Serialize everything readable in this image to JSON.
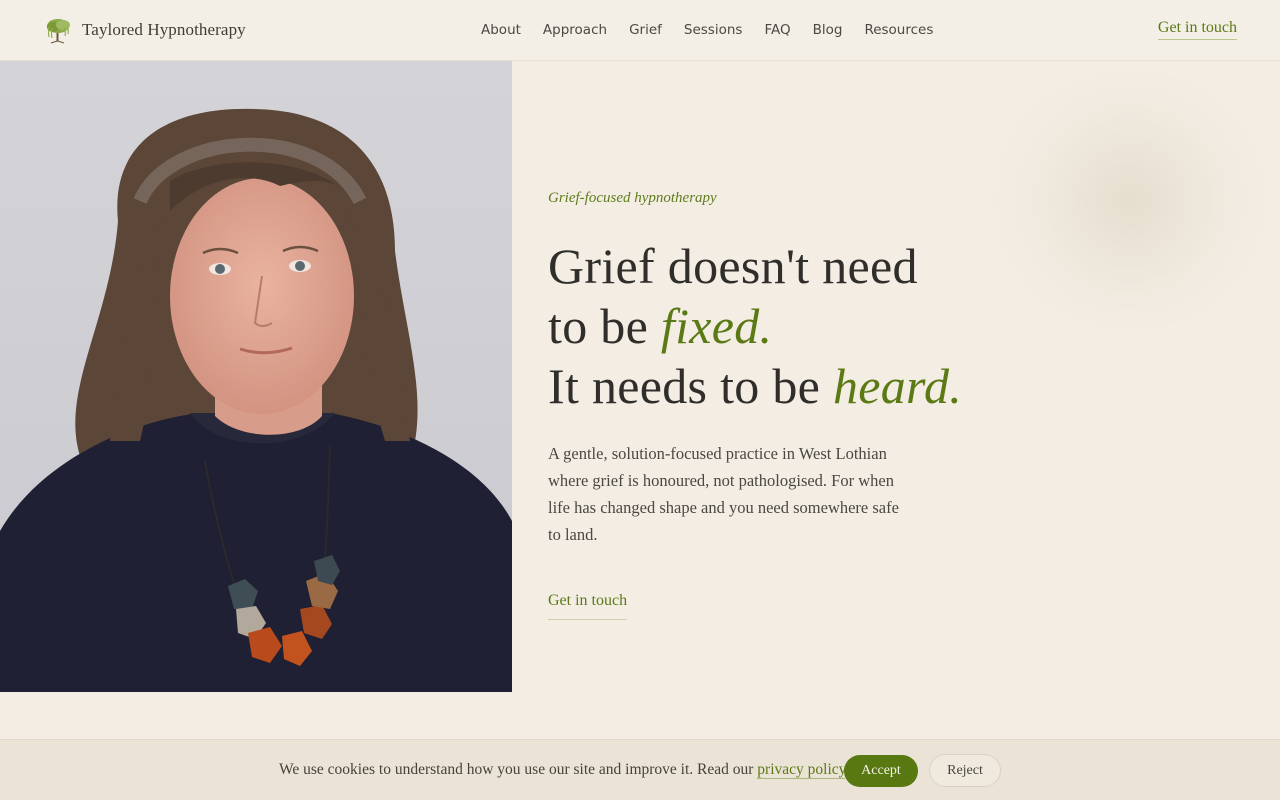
{
  "brand": {
    "name": "Taylored Hypnotherapy",
    "logo_icon": "willow-tree-icon"
  },
  "nav": {
    "items": [
      "About",
      "Approach",
      "Grief",
      "Sessions",
      "FAQ",
      "Blog",
      "Resources"
    ]
  },
  "header": {
    "cta_label": "Get in touch"
  },
  "hero": {
    "photo_alt": "Portrait of therapist",
    "eyebrow": "Grief-focused hypnotherapy",
    "headline": {
      "line1": "Grief doesn't need",
      "line2_plain": "to be ",
      "line2_emph": "fixed.",
      "line3_plain": "It needs to be ",
      "line3_emph": "heard."
    },
    "lede": "A gentle, solution-focused practice in West Lothian where grief is honoured, not pathologised. For when life has changed shape and you need somewhere safe to land.",
    "cta_label": "Get in touch"
  },
  "cookie": {
    "text_before": "We use cookies to understand how you use our site and improve it. Read our ",
    "link_label": "privacy policy",
    "text_after": ".",
    "accept_label": "Accept",
    "reject_label": "Reject"
  },
  "colors": {
    "background": "#f3ede4",
    "accent": "#5b7a15",
    "accept_button": "#587812",
    "text": "#2f2e2a"
  }
}
